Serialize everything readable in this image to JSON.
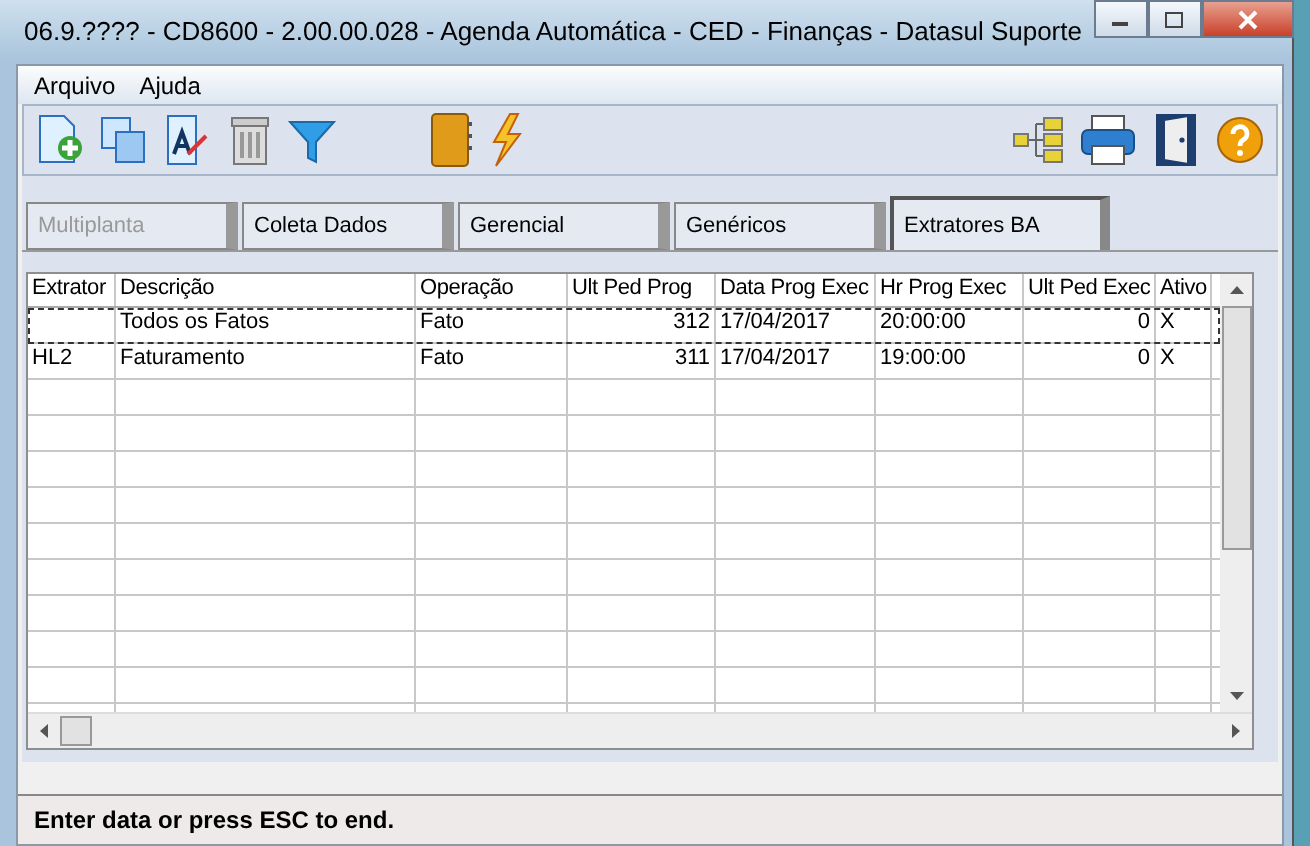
{
  "window": {
    "title": "06.9.???? - CD8600 - 2.00.00.028 - Agenda Automática - CED - Finanças - Datasul Suporte"
  },
  "menu": [
    "Arquivo",
    "Ajuda"
  ],
  "tabs": [
    {
      "label": "Multiplanta",
      "selected": false,
      "disabled": true
    },
    {
      "label": "Coleta Dados",
      "selected": false,
      "disabled": false
    },
    {
      "label": "Gerencial",
      "selected": false,
      "disabled": false
    },
    {
      "label": "Genéricos",
      "selected": false,
      "disabled": false
    },
    {
      "label": "Extratores BA",
      "selected": true,
      "disabled": false
    }
  ],
  "table": {
    "columns": [
      "Extrator",
      "Descrição",
      "Operação",
      "Ult Ped Prog",
      "Data Prog Exec",
      "Hr Prog Exec",
      "Ult Ped Exec",
      "Ativo"
    ],
    "rows": [
      {
        "selected": true,
        "cells": [
          "",
          "Todos os Fatos",
          "Fato",
          "312",
          "17/04/2017",
          "20:00:00",
          "0",
          "X"
        ]
      },
      {
        "selected": false,
        "cells": [
          "HL2",
          "Faturamento",
          "Fato",
          "311",
          "17/04/2017",
          "19:00:00",
          "0",
          "X"
        ]
      }
    ]
  },
  "status_bar": "Enter data or press ESC to end."
}
